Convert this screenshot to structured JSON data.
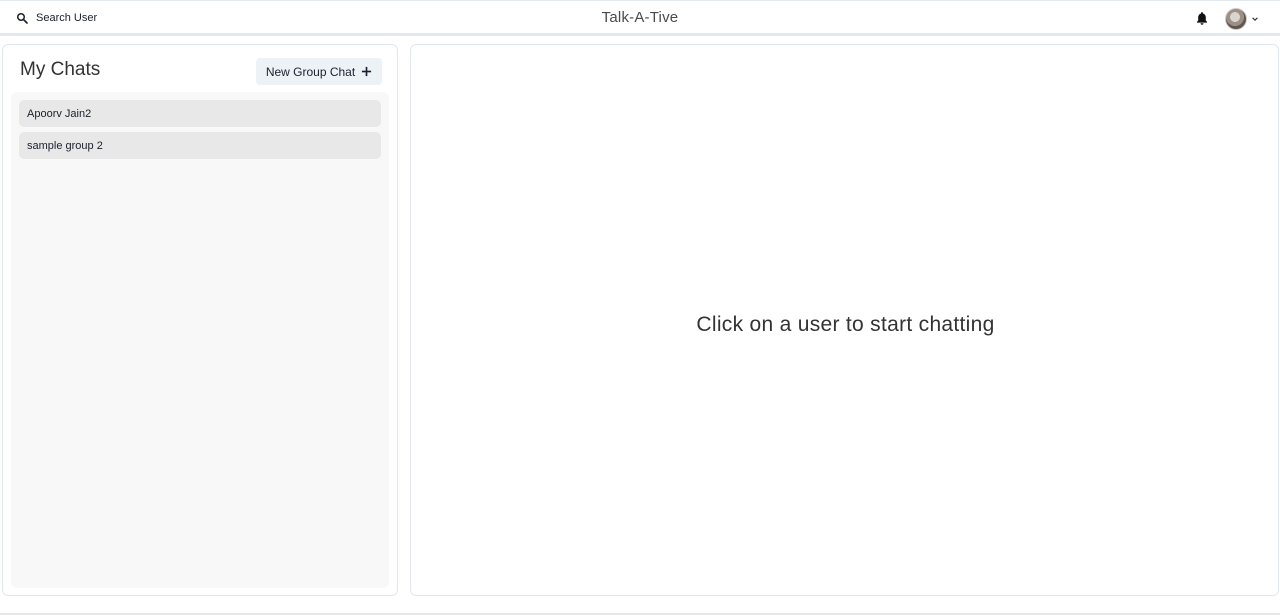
{
  "header": {
    "search_label": "Search User",
    "app_title": "Talk-A-Tive",
    "icons": {
      "search": "search-icon",
      "notifications": "bell-icon",
      "avatar": "avatar",
      "menu": "chevron-down-icon"
    }
  },
  "sidebar": {
    "title": "My Chats",
    "new_group_label": "New Group Chat",
    "new_group_icon": "plus-icon",
    "chats": [
      {
        "name": "Apoorv Jain2"
      },
      {
        "name": "sample group 2"
      }
    ]
  },
  "main": {
    "empty_message": "Click on a user to start chatting"
  },
  "colors": {
    "border": "#e2e8f0",
    "button_bg": "#edf2f7",
    "list_bg": "#f8f8f8",
    "item_bg": "#e8e8e8",
    "text": "#1a202c"
  }
}
